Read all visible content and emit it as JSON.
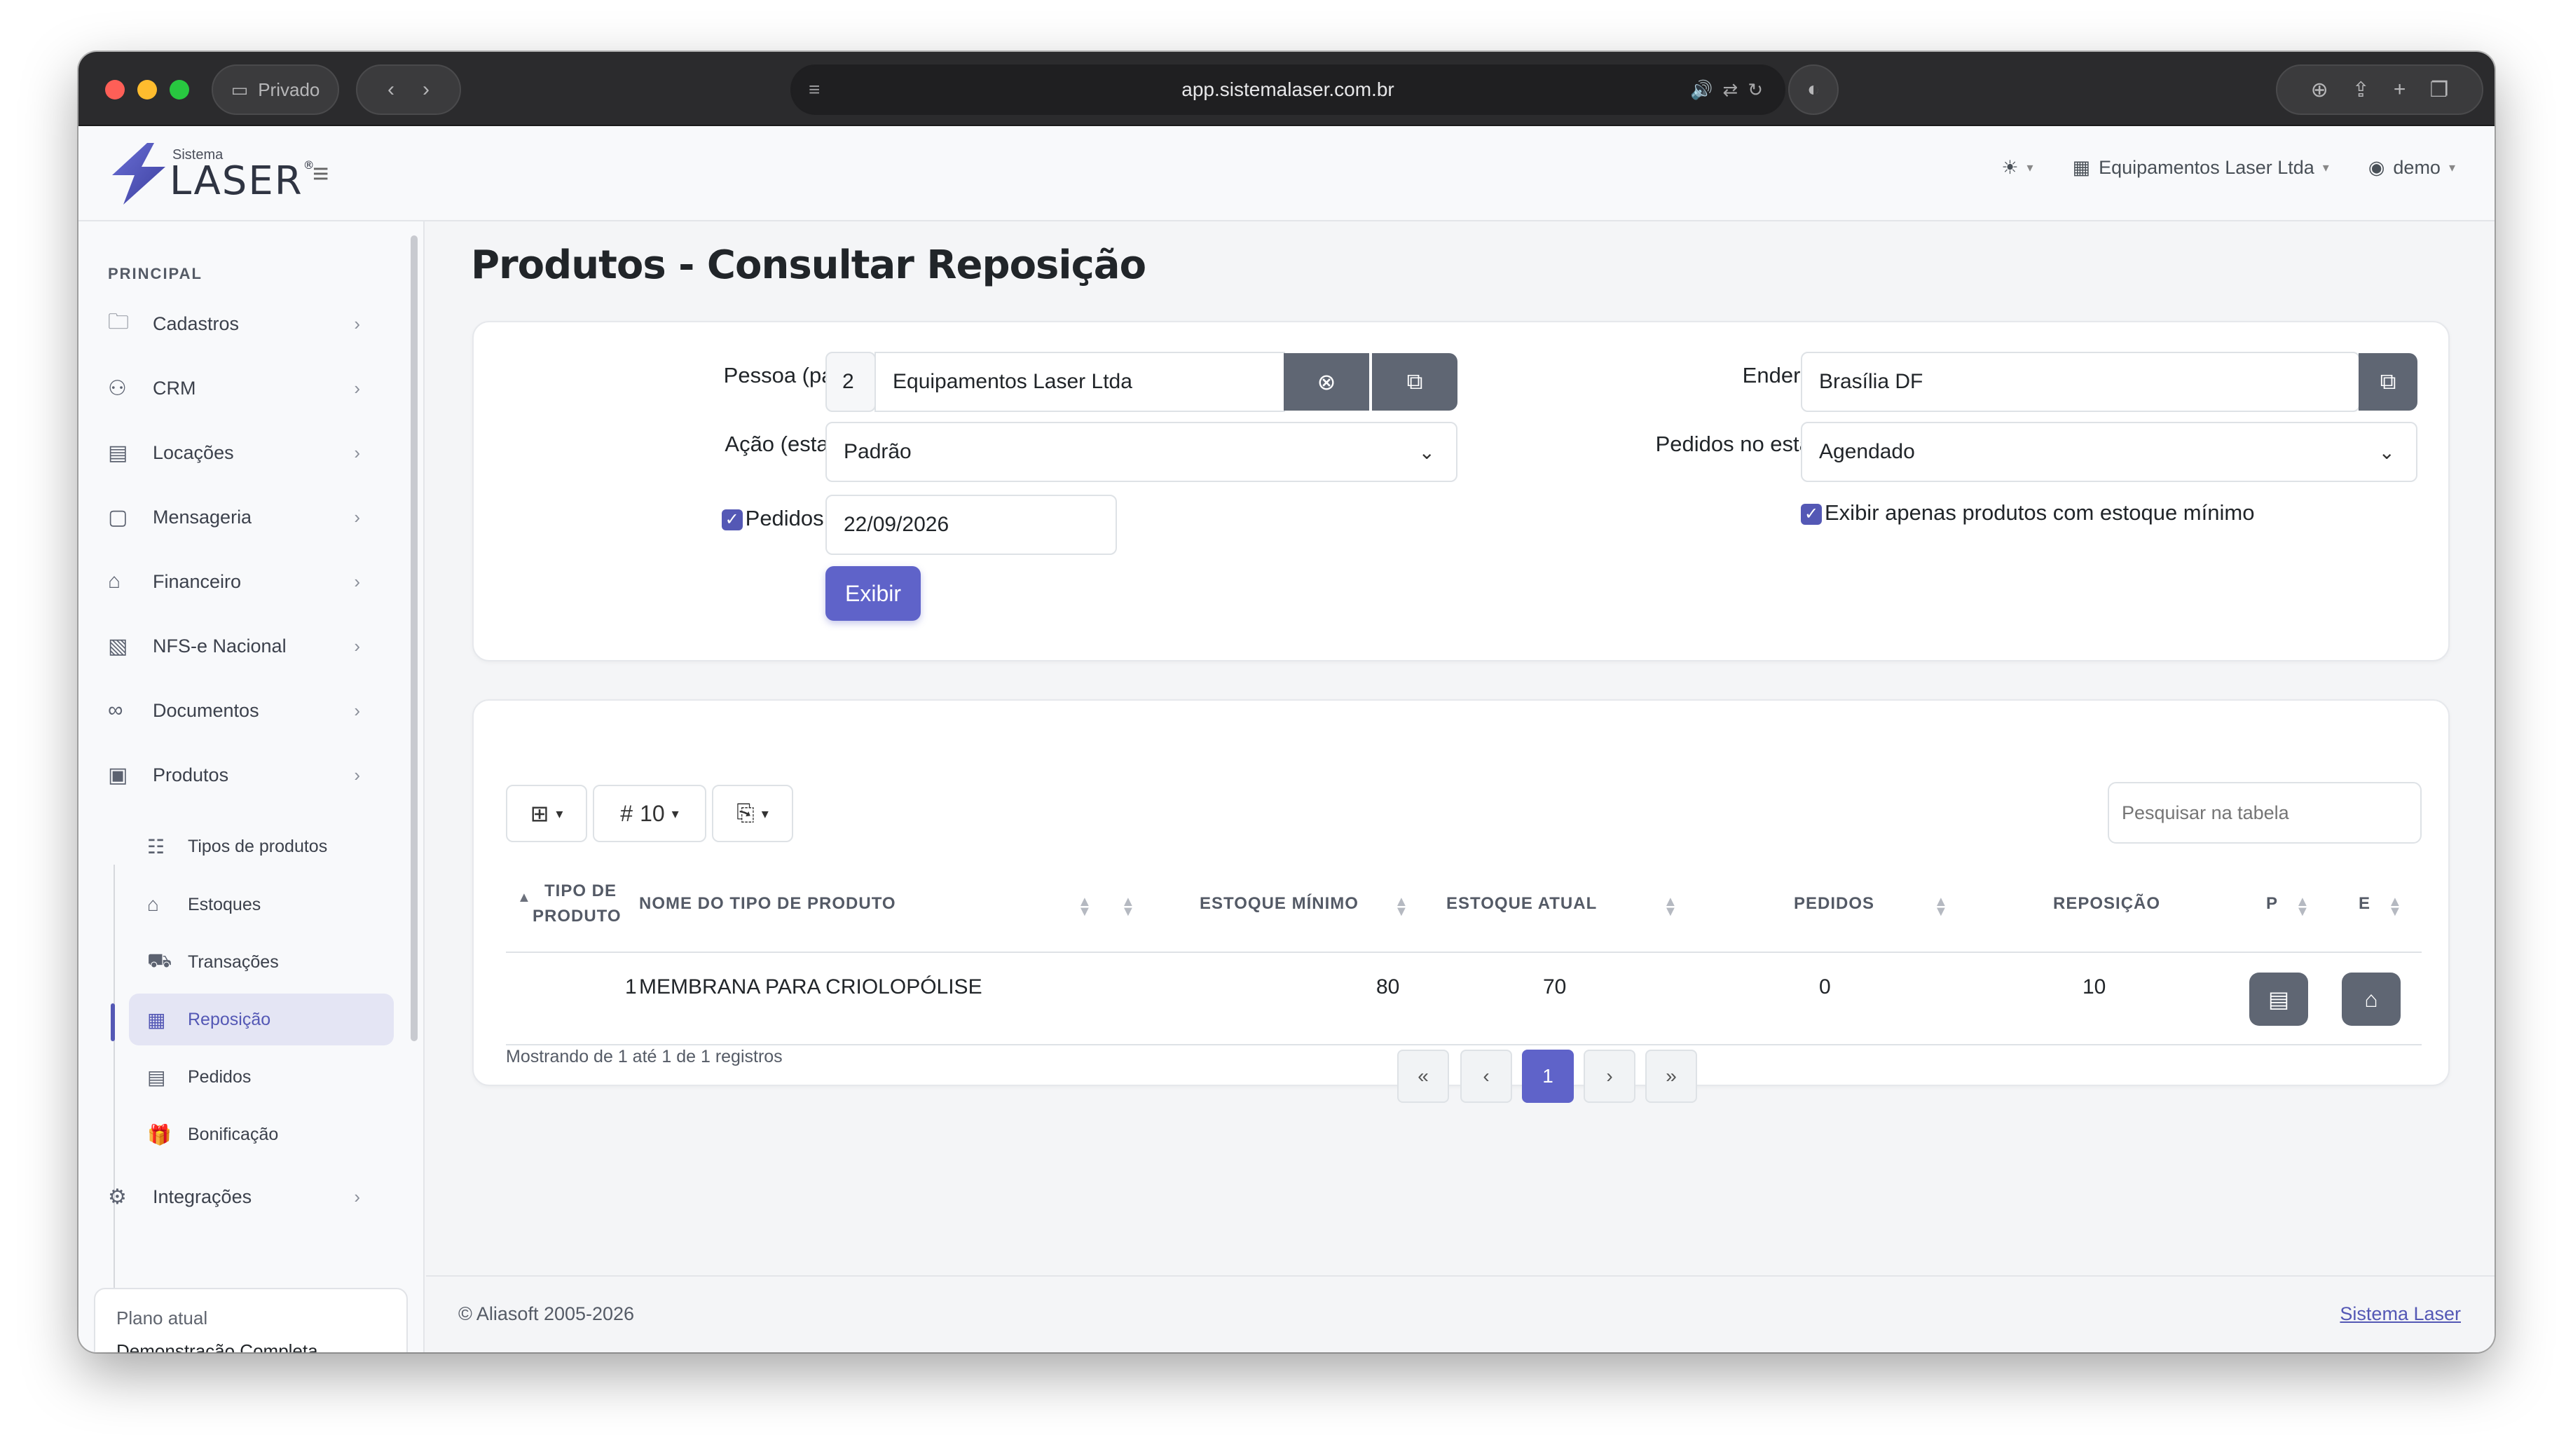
{
  "browser": {
    "private_label": "Privado",
    "url": "app.sistemalaser.com.br"
  },
  "header": {
    "brand_small": "Sistema",
    "brand_big": "LASER",
    "company": "Equipamentos Laser Ltda",
    "user": "demo"
  },
  "sidebar": {
    "section": "PRINCIPAL",
    "items": [
      {
        "label": "Cadastros",
        "icon": "folder-icon"
      },
      {
        "label": "CRM",
        "icon": "network-icon"
      },
      {
        "label": "Locações",
        "icon": "calendar-icon"
      },
      {
        "label": "Mensageria",
        "icon": "chat-icon"
      },
      {
        "label": "Financeiro",
        "icon": "finance-icon"
      },
      {
        "label": "NFS-e Nacional",
        "icon": "invoice-icon"
      },
      {
        "label": "Documentos",
        "icon": "document-icon"
      },
      {
        "label": "Produtos",
        "icon": "box-icon"
      }
    ],
    "sub_items": [
      {
        "label": "Tipos de produtos"
      },
      {
        "label": "Estoques"
      },
      {
        "label": "Transações"
      },
      {
        "label": "Reposição"
      },
      {
        "label": "Pedidos"
      },
      {
        "label": "Bonificação"
      }
    ],
    "integracoes": "Integrações",
    "plan_label": "Plano atual",
    "plan_value": "Demonstração Completa"
  },
  "page": {
    "title": "Produtos - Consultar Reposição"
  },
  "filters": {
    "pessoa_label": "Pessoa (para):",
    "pessoa_id": "2",
    "pessoa_name": "Equipamentos Laser Ltda",
    "endereco_label": "Endereço:",
    "endereco_value": "Brasília DF",
    "acao_label": "Ação (estado):",
    "acao_value": "Padrão",
    "pedidos_estado_label": "Pedidos no estado:",
    "pedidos_estado_value": "Agendado",
    "pedidos_ate_label": "Pedidos até:",
    "pedidos_ate_value": "22/09/2026",
    "estoque_minimo_label": "Exibir apenas produtos com estoque mínimo",
    "exibir_button": "Exibir"
  },
  "table": {
    "page_size": "10",
    "search_placeholder": "Pesquisar na tabela",
    "headers": {
      "tipo_l1": "TIPO DE",
      "tipo_l2": "PRODUTO",
      "nome": "NOME DO TIPO DE PRODUTO",
      "estoque_minimo": "ESTOQUE MÍNIMO",
      "estoque_atual": "ESTOQUE ATUAL",
      "pedidos": "PEDIDOS",
      "reposicao": "REPOSIÇÃO",
      "p": "P",
      "e": "E"
    },
    "rows": [
      {
        "tipo": "1",
        "nome": "MEMBRANA PARA CRIOLOPÓLISE",
        "estoque_minimo": "80",
        "estoque_atual": "70",
        "pedidos": "0",
        "reposicao": "10"
      }
    ],
    "info": "Mostrando de 1 até 1 de 1 registros",
    "pagination": {
      "first": "«",
      "prev": "‹",
      "current": "1",
      "next": "›",
      "last": "»"
    }
  },
  "footer": {
    "copyright": "© Aliasoft 2005-2026",
    "link": "Sistema Laser"
  },
  "colors": {
    "accent": "#5f63c9",
    "dark_button": "#5f6673"
  }
}
